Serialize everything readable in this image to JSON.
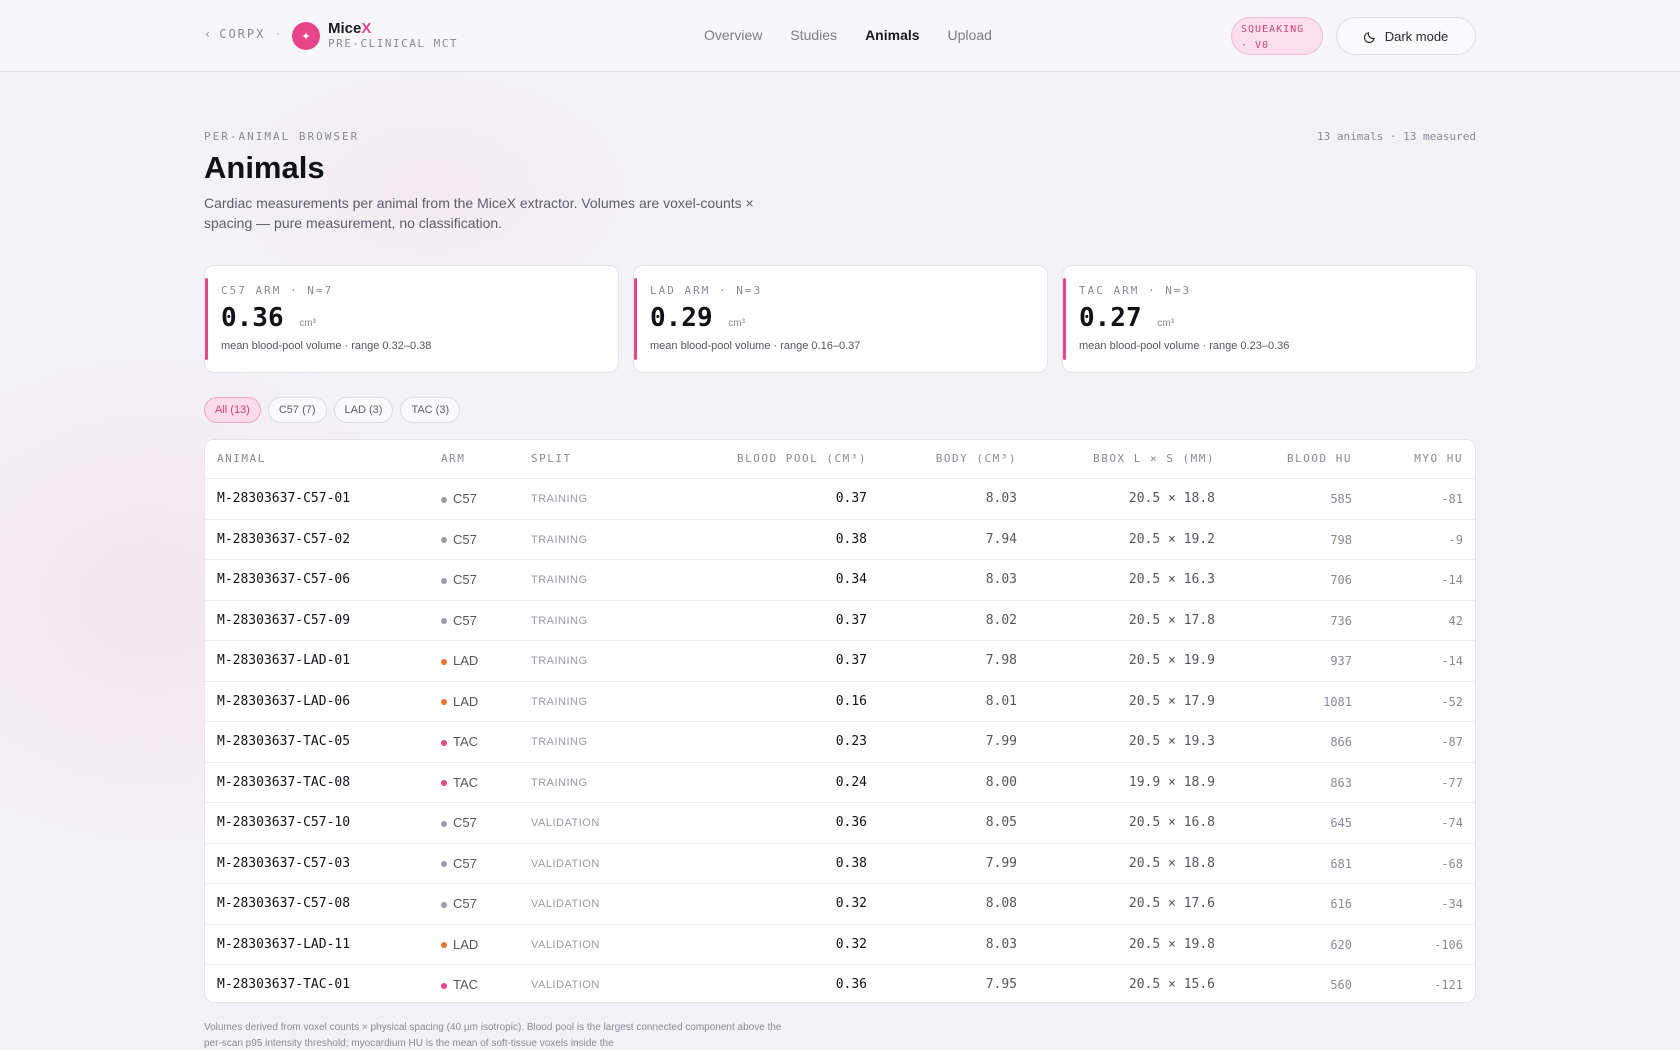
{
  "header": {
    "back_label": "CORPX",
    "brand_name": "Mice",
    "brand_x": "X",
    "brand_sub": "PRE-CLINICAL MCT",
    "nav": [
      "Overview",
      "Studies",
      "Animals",
      "Upload"
    ],
    "active_nav": "Animals",
    "badge_line1": "SQUEAKING",
    "badge_line2": "· V0",
    "dark_mode_label": "Dark mode"
  },
  "page": {
    "eyebrow": "PER-ANIMAL BROWSER",
    "count": "13 animals · 13 measured",
    "title": "Animals",
    "lede": "Cardiac measurements per animal from the MiceX extractor. Volumes are voxel-counts × spacing — pure measurement, no classification."
  },
  "cards": [
    {
      "label": "C57 ARM · N=7",
      "value": "0.36",
      "unit": "cm³",
      "note": "mean blood-pool volume · range 0.32–0.38"
    },
    {
      "label": "LAD ARM · N=3",
      "value": "0.29",
      "unit": "cm³",
      "note": "mean blood-pool volume · range 0.16–0.37"
    },
    {
      "label": "TAC ARM · N=3",
      "value": "0.27",
      "unit": "cm³",
      "note": "mean blood-pool volume · range 0.23–0.36"
    }
  ],
  "filters": [
    "All (13)",
    "C57 (7)",
    "LAD (3)",
    "TAC (3)"
  ],
  "active_filter": 0,
  "arm_colors": {
    "C57": "#9a9cb0",
    "LAD": "#e8762c",
    "TAC": "#e8458b"
  },
  "table": {
    "columns": [
      "ANIMAL",
      "ARM",
      "SPLIT",
      "BLOOD POOL (CM³)",
      "BODY (CM³)",
      "BBOX L × S (MM)",
      "BLOOD HU",
      "MYO HU"
    ],
    "rows": [
      [
        "M-28303637-C57-01",
        "C57",
        "TRAINING",
        "0.37",
        "8.03",
        "20.5 × 18.8",
        "585",
        "-81"
      ],
      [
        "M-28303637-C57-02",
        "C57",
        "TRAINING",
        "0.38",
        "7.94",
        "20.5 × 19.2",
        "798",
        "-9"
      ],
      [
        "M-28303637-C57-06",
        "C57",
        "TRAINING",
        "0.34",
        "8.03",
        "20.5 × 16.3",
        "706",
        "-14"
      ],
      [
        "M-28303637-C57-09",
        "C57",
        "TRAINING",
        "0.37",
        "8.02",
        "20.5 × 17.8",
        "736",
        "42"
      ],
      [
        "M-28303637-LAD-01",
        "LAD",
        "TRAINING",
        "0.37",
        "7.98",
        "20.5 × 19.9",
        "937",
        "-14"
      ],
      [
        "M-28303637-LAD-06",
        "LAD",
        "TRAINING",
        "0.16",
        "8.01",
        "20.5 × 17.9",
        "1081",
        "-52"
      ],
      [
        "M-28303637-TAC-05",
        "TAC",
        "TRAINING",
        "0.23",
        "7.99",
        "20.5 × 19.3",
        "866",
        "-87"
      ],
      [
        "M-28303637-TAC-08",
        "TAC",
        "TRAINING",
        "0.24",
        "8.00",
        "19.9 × 18.9",
        "863",
        "-77"
      ],
      [
        "M-28303637-C57-10",
        "C57",
        "VALIDATION",
        "0.36",
        "8.05",
        "20.5 × 16.8",
        "645",
        "-74"
      ],
      [
        "M-28303637-C57-03",
        "C57",
        "VALIDATION",
        "0.38",
        "7.99",
        "20.5 × 18.8",
        "681",
        "-68"
      ],
      [
        "M-28303637-C57-08",
        "C57",
        "VALIDATION",
        "0.32",
        "8.08",
        "20.5 × 17.6",
        "616",
        "-34"
      ],
      [
        "M-28303637-LAD-11",
        "LAD",
        "VALIDATION",
        "0.32",
        "8.03",
        "20.5 × 19.8",
        "620",
        "-106"
      ],
      [
        "M-28303637-TAC-01",
        "TAC",
        "VALIDATION",
        "0.36",
        "7.95",
        "20.5 × 15.6",
        "560",
        "-121"
      ]
    ]
  },
  "footnote": "Volumes derived from voxel counts × physical spacing (40 µm isotropic). Blood pool is the largest connected component above the per-scan p95 intensity threshold; myocardium HU is the mean of soft-tissue voxels inside the"
}
